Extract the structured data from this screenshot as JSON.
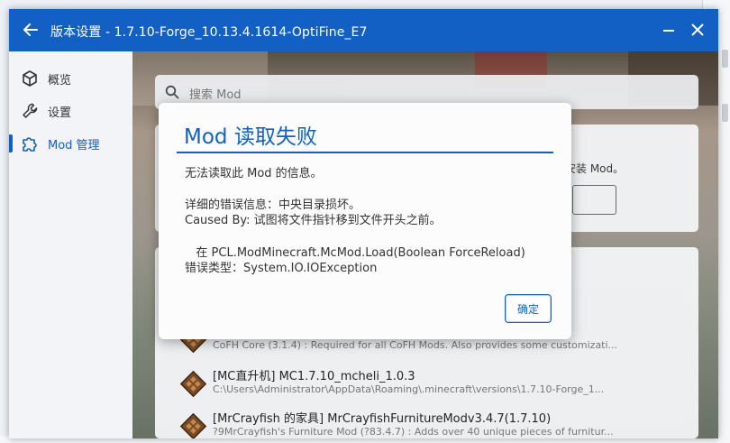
{
  "window": {
    "title": "版本设置 - 1.7.10-Forge_10.13.4.1614-OptiFine_E7",
    "accent_color": "#1260c3"
  },
  "sidebar": {
    "items": [
      {
        "label": "概览",
        "icon": "cube-icon"
      },
      {
        "label": "设置",
        "icon": "wrench-icon"
      },
      {
        "label": "Mod 管理",
        "icon": "puzzle-icon",
        "active": true
      }
    ]
  },
  "search": {
    "placeholder": "搜索 Mod"
  },
  "install_card": {
    "hint": "安装 Mod。"
  },
  "mods": [
    {
      "name": "",
      "desc": "CoFH Core (3.1.4) : Required for all CoFH Mods. Also provides some customizati..."
    },
    {
      "name": "[MC直升机] MC1.7.10_mcheli_1.0.3",
      "desc": "C:\\Users\\Administrator\\AppData\\Roaming\\.minecraft\\versions\\1.7.10-Forge_1..."
    },
    {
      "name": "[MrCrayfish 的家具] MrCrayfishFurnitureModv3.4.7(1.7.10)",
      "desc": "?9MrCrayfish's Furniture Mod (?83.4.7) : Adds over 40 unique pieces of furnitur..."
    }
  ],
  "dialog": {
    "title": "Mod 读取失败",
    "line1": "无法读取此 Mod 的信息。",
    "line2": "详细的错误信息：中央目录损坏。",
    "line3": "Caused By: 试图将文件指针移到文件开头之前。",
    "line4": "   在 PCL.ModMinecraft.McMod.Load(Boolean ForceReload)",
    "line5": "错误类型：System.IO.IOException",
    "ok_label": "确定"
  }
}
